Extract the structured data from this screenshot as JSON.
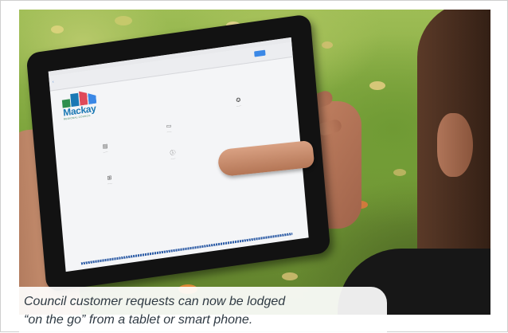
{
  "photo": {
    "tablet_screen": {
      "logo": {
        "name": "Mackay",
        "subtitle": "REGIONAL COUNCIL",
        "colors": [
          "#2f8f4e",
          "#1a78b4",
          "#e04a5a",
          "#3b88e6"
        ]
      },
      "apps": [
        {
          "icon": "document-icon"
        },
        {
          "icon": "flag-icon"
        },
        {
          "icon": "cart-icon"
        },
        {
          "icon": "info-icon"
        },
        {
          "icon": "gear-icon"
        }
      ]
    }
  },
  "caption": {
    "line1": "Council customer requests can now be lodged",
    "line2": "“on the go” from a tablet or smart phone."
  }
}
